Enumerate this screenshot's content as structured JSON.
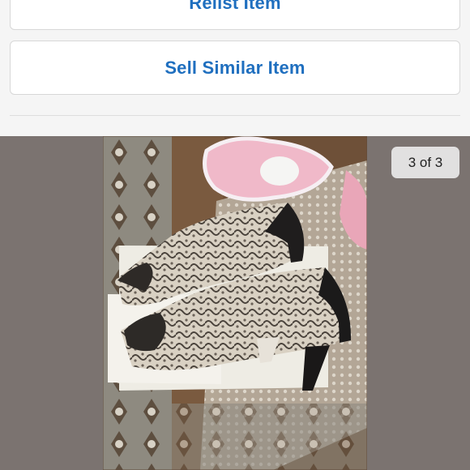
{
  "actions": {
    "relist_label": "Relist Item",
    "sell_similar_label": "Sell Similar Item"
  },
  "gallery": {
    "counter": "3 of 3",
    "current_index": 3,
    "total": 3,
    "background_color": "#7b7370"
  },
  "colors": {
    "accent": "#1f6fbf"
  }
}
